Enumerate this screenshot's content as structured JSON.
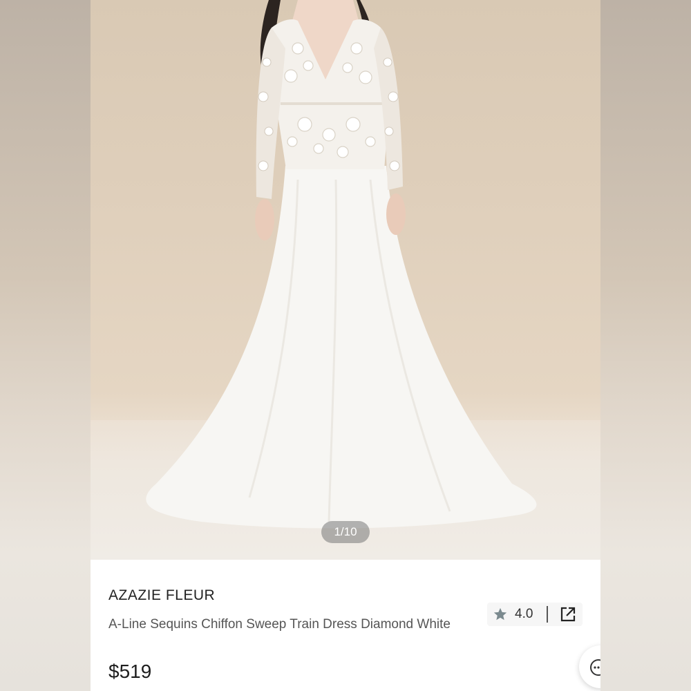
{
  "gallery": {
    "page_indicator": "1/10"
  },
  "product": {
    "brand": "AZAZIE FLEUR",
    "name": "A-Line Sequins Chiffon Sweep Train Dress Diamond White",
    "price": "$519"
  },
  "rating": {
    "value": "4.0",
    "icon": "star-icon"
  },
  "actions": {
    "share_icon": "share-external-icon",
    "chat_icon": "chat-icon"
  },
  "colors": {
    "star": "#7b8a8f",
    "indicator_bg": "#8a8a8a",
    "price_text": "#1e1e1e"
  }
}
